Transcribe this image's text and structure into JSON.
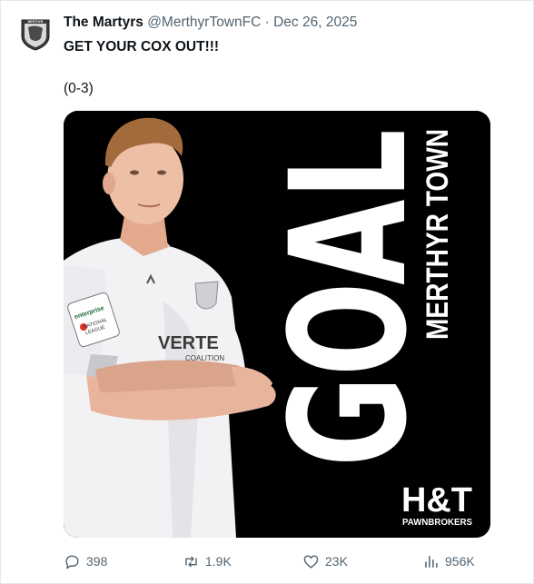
{
  "post": {
    "author_name": "The Martyrs",
    "author_handle": "@MerthyrTownFC",
    "separator": "·",
    "date": "Dec 26, 2025",
    "text": "GET YOUR COX OUT!!!",
    "score": "(0-3)"
  },
  "avatar": {
    "crest_text": "MERTHYR"
  },
  "media": {
    "headline": "GOAL",
    "club": "MERTHYR TOWN",
    "sponsor_main": "H&T",
    "sponsor_sub": "PAWNBROKERS",
    "shirt_sponsor": "VERTE",
    "shirt_sponsor_sub": "COALITION",
    "sleeve_badge_brand": "enterprise",
    "sleeve_badge_league_1": "NATIONAL",
    "sleeve_badge_league_2": "LEAGUE"
  },
  "actions": {
    "replies": {
      "icon": "reply-icon",
      "count": "398"
    },
    "reposts": {
      "icon": "repost-icon",
      "count": "1.9K"
    },
    "likes": {
      "icon": "like-icon",
      "count": "23K"
    },
    "views": {
      "icon": "views-icon",
      "count": "956K"
    }
  },
  "colors": {
    "text": "#0f1419",
    "muted": "#536471",
    "border": "#e6e9ec",
    "media_bg": "#000000",
    "accent_red": "#e0312b"
  }
}
